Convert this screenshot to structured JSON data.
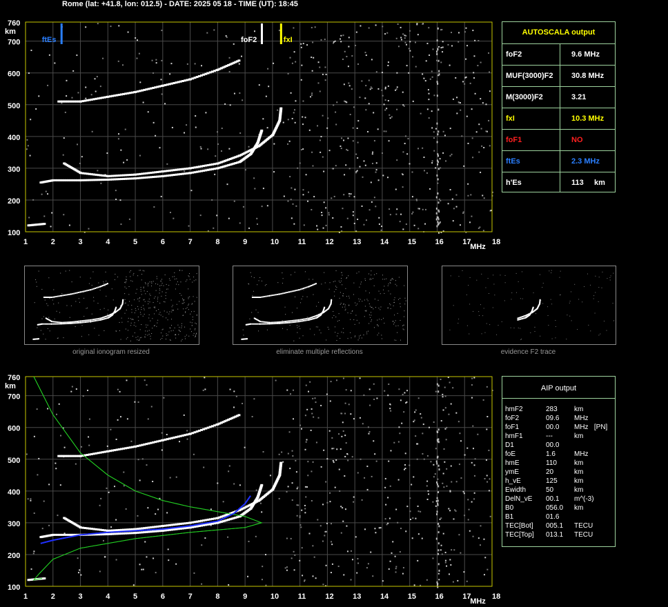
{
  "header": "Rome (lat: +41.8, lon: 012.5) - DATE: 2025 05 18 - TIME (UT): 18:45",
  "colors": {
    "trace": "#ffffff",
    "grid": "#4a4a4a",
    "frame": "#c8c800",
    "table_border": "#9fd49f",
    "yellow": "#ffff00",
    "red": "#ff2020",
    "blue": "#2a7fff",
    "green": "#22cc22",
    "aip_trace": "#2030ff"
  },
  "chart_data": [
    {
      "type": "scatter",
      "title": "",
      "xlabel": "MHz",
      "ylabel": "km",
      "xlim": [
        1,
        18
      ],
      "ylim": [
        100,
        760
      ],
      "x_ticks": [
        "1",
        "2",
        "3",
        "4",
        "5",
        "6",
        "7",
        "8",
        "9",
        "10",
        "11",
        "12",
        "13",
        "14",
        "15",
        "16",
        "17",
        "18"
      ],
      "y_ticks": [
        "100",
        "200",
        "300",
        "400",
        "500",
        "600",
        "700",
        "760"
      ],
      "grid": true,
      "markers": [
        {
          "label": "ftEs",
          "x": 2.3,
          "color": "blue"
        },
        {
          "label": "foF2",
          "x": 9.6,
          "color": "white"
        },
        {
          "label": "fxI",
          "x": 10.3,
          "color": "yellow"
        }
      ],
      "series": [
        {
          "values": [
            [
              1.55,
              255
            ],
            [
              2.0,
              262
            ],
            [
              3.0,
              262
            ],
            [
              4.0,
              264
            ],
            [
              5.0,
              268
            ],
            [
              6.0,
              275
            ],
            [
              7.0,
              285
            ],
            [
              8.0,
              300
            ],
            [
              8.8,
              320
            ],
            [
              9.2,
              345
            ],
            [
              9.45,
              380
            ],
            [
              9.6,
              420
            ]
          ]
        },
        {
          "values": [
            [
              2.4,
              315
            ],
            [
              3.0,
              285
            ],
            [
              4.0,
              275
            ],
            [
              5.0,
              280
            ],
            [
              6.0,
              290
            ],
            [
              7.0,
              300
            ],
            [
              8.0,
              315
            ],
            [
              8.8,
              340
            ],
            [
              9.5,
              370
            ],
            [
              10.0,
              405
            ],
            [
              10.25,
              450
            ],
            [
              10.3,
              490
            ]
          ]
        },
        {
          "values": [
            [
              2.2,
              510
            ],
            [
              3.0,
              510
            ],
            [
              4.0,
              525
            ],
            [
              5.0,
              540
            ],
            [
              6.0,
              560
            ],
            [
              7.0,
              580
            ],
            [
              8.0,
              610
            ],
            [
              8.8,
              640
            ]
          ]
        },
        {
          "values": [
            [
              1.1,
              120
            ],
            [
              1.7,
              125
            ]
          ]
        }
      ]
    },
    {
      "type": "line",
      "title": "",
      "xlabel": "MHz",
      "ylabel": "km",
      "xlim": [
        1,
        18
      ],
      "ylim": [
        100,
        760
      ],
      "x_ticks": [
        "1",
        "2",
        "3",
        "4",
        "5",
        "6",
        "7",
        "8",
        "9",
        "10",
        "11",
        "12",
        "13",
        "14",
        "15",
        "16",
        "17",
        "18"
      ],
      "y_ticks": [
        "100",
        "200",
        "300",
        "400",
        "500",
        "600",
        "700",
        "760"
      ],
      "grid": true,
      "series": [
        {
          "values": [
            [
              1.3,
              760
            ],
            [
              2.0,
              640
            ],
            [
              3.0,
              520
            ],
            [
              4.0,
              450
            ],
            [
              5.0,
              400
            ],
            [
              6.0,
              370
            ],
            [
              7.0,
              350
            ],
            [
              8.0,
              335
            ],
            [
              9.0,
              320
            ],
            [
              9.6,
              300
            ],
            [
              9.0,
              285
            ],
            [
              7.0,
              270
            ],
            [
              5.0,
              250
            ],
            [
              3.0,
              220
            ],
            [
              2.0,
              185
            ],
            [
              1.5,
              140
            ],
            [
              1.3,
              120
            ],
            [
              1.6,
              125
            ]
          ]
        },
        {
          "values": [
            [
              1.55,
              235
            ],
            [
              2.0,
              245
            ],
            [
              3.0,
              262
            ],
            [
              4.0,
              270
            ],
            [
              5.0,
              275
            ],
            [
              6.0,
              280
            ],
            [
              7.0,
              290
            ],
            [
              8.0,
              305
            ],
            [
              8.6,
              330
            ],
            [
              9.0,
              360
            ],
            [
              9.2,
              385
            ]
          ]
        }
      ]
    }
  ],
  "autoscala": {
    "title": "AUTOSCALA output",
    "rows": [
      {
        "label": "foF2",
        "value": "9.6 MHz",
        "color": "white"
      },
      {
        "label": "MUF(3000)F2",
        "value": "30.8 MHz",
        "color": "white"
      },
      {
        "label": "M(3000)F2",
        "value": "3.21",
        "color": "white"
      },
      {
        "label": "fxI",
        "value": "10.3 MHz",
        "color": "yellow"
      },
      {
        "label": "foF1",
        "value": "NO",
        "color": "red"
      },
      {
        "label": "ftEs",
        "value": "2.3 MHz",
        "color": "blue"
      },
      {
        "label": "h'Es",
        "value": "113     km",
        "color": "white"
      }
    ]
  },
  "thumbnails": [
    {
      "caption": "original ionogram resized"
    },
    {
      "caption": "eliminate multiple reflections"
    },
    {
      "caption": "evidence F2 trace"
    }
  ],
  "aip": {
    "title": "AIP output",
    "rows": [
      {
        "name": "hmF2",
        "value": "283",
        "unit": "km"
      },
      {
        "name": "foF2",
        "value": "09.6",
        "unit": "MHz"
      },
      {
        "name": "foF1",
        "value": "00.0",
        "unit": "MHz   [PN]"
      },
      {
        "name": "hmF1",
        "value": "---",
        "unit": "km"
      },
      {
        "name": "D1",
        "value": "00.0",
        "unit": ""
      },
      {
        "name": "foE",
        "value": "1.6",
        "unit": "MHz"
      },
      {
        "name": "hmE",
        "value": "110",
        "unit": "km"
      },
      {
        "name": "ymE",
        "value": "20",
        "unit": "km"
      },
      {
        "name": "h_vE",
        "value": "125",
        "unit": "km"
      },
      {
        "name": "Ewidth",
        "value": "50",
        "unit": "km"
      },
      {
        "name": "DelN_vE",
        "value": "00.1",
        "unit": "m^(-3)"
      },
      {
        "name": "B0",
        "value": "056.0",
        "unit": "km"
      },
      {
        "name": "B1",
        "value": "01.6",
        "unit": ""
      },
      {
        "name": "TEC[Bot]",
        "value": "005.1",
        "unit": "TECU"
      },
      {
        "name": "TEC[Top]",
        "value": "013.1",
        "unit": "TECU"
      }
    ]
  }
}
